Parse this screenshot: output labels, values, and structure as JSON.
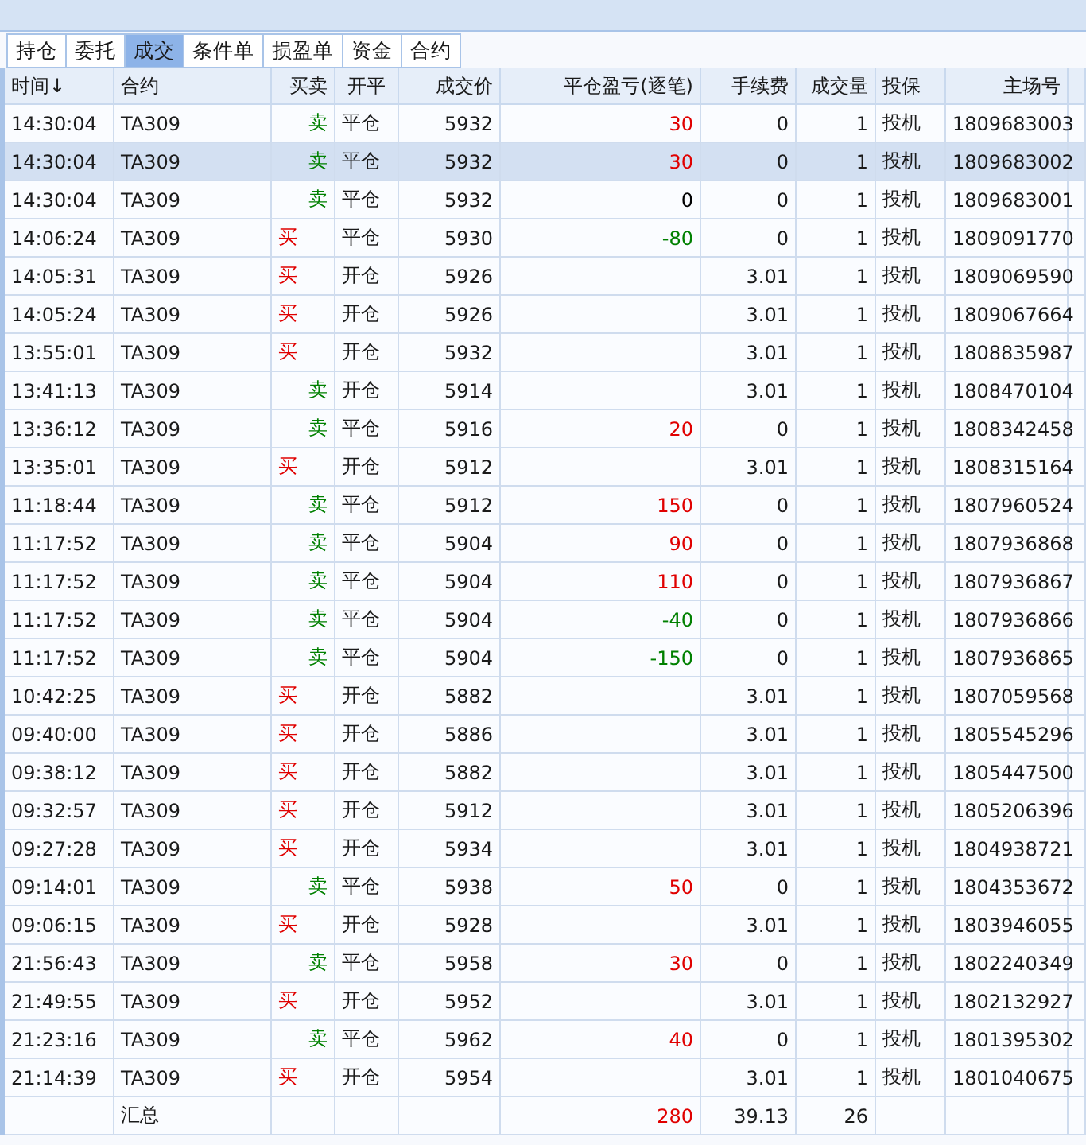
{
  "tabs": [
    {
      "label": "持仓",
      "selected": false
    },
    {
      "label": "委托",
      "selected": false
    },
    {
      "label": "成交",
      "selected": true
    },
    {
      "label": "条件单",
      "selected": false
    },
    {
      "label": "损盈单",
      "selected": false
    },
    {
      "label": "资金",
      "selected": false
    },
    {
      "label": "合约",
      "selected": false
    }
  ],
  "table": {
    "columns": [
      "时间↓",
      "合约",
      "买卖",
      "开平",
      "成交价",
      "平仓盈亏(逐笔)",
      "手续费",
      "成交量",
      "投保",
      "主场号"
    ],
    "rows": [
      {
        "time": "14:30:04",
        "contract": "TA309",
        "side": "卖",
        "kind": "sell",
        "oc": "平仓",
        "price": "5932",
        "pnl": "30",
        "color": "#e00000",
        "fee": "0",
        "volume": "1",
        "hedge": "投机",
        "id": "1809683003",
        "selected": false
      },
      {
        "time": "14:30:04",
        "contract": "TA309",
        "side": "卖",
        "kind": "sell",
        "oc": "平仓",
        "price": "5932",
        "pnl": "30",
        "color": "#e00000",
        "fee": "0",
        "volume": "1",
        "hedge": "投机",
        "id": "1809683002",
        "selected": true
      },
      {
        "time": "14:30:04",
        "contract": "TA309",
        "side": "卖",
        "kind": "sell",
        "oc": "平仓",
        "price": "5932",
        "pnl": "0",
        "color": "#000000",
        "fee": "0",
        "volume": "1",
        "hedge": "投机",
        "id": "1809683001",
        "selected": false
      },
      {
        "time": "14:06:24",
        "contract": "TA309",
        "side": "买",
        "kind": "buy",
        "oc": "平仓",
        "price": "5930",
        "pnl": "-80",
        "color": "#008000",
        "fee": "0",
        "volume": "1",
        "hedge": "投机",
        "id": "1809091770",
        "selected": false
      },
      {
        "time": "14:05:31",
        "contract": "TA309",
        "side": "买",
        "kind": "buy",
        "oc": "开仓",
        "price": "5926",
        "fee": "3.01",
        "volume": "1",
        "hedge": "投机",
        "id": "1809069590",
        "selected": false
      },
      {
        "time": "14:05:24",
        "contract": "TA309",
        "side": "买",
        "kind": "buy",
        "oc": "开仓",
        "price": "5926",
        "fee": "3.01",
        "volume": "1",
        "hedge": "投机",
        "id": "1809067664",
        "selected": false
      },
      {
        "time": "13:55:01",
        "contract": "TA309",
        "side": "买",
        "kind": "buy",
        "oc": "开仓",
        "price": "5932",
        "fee": "3.01",
        "volume": "1",
        "hedge": "投机",
        "id": "1808835987",
        "selected": false
      },
      {
        "time": "13:41:13",
        "contract": "TA309",
        "side": "卖",
        "kind": "sell",
        "oc": "开仓",
        "price": "5914",
        "fee": "3.01",
        "volume": "1",
        "hedge": "投机",
        "id": "1808470104",
        "selected": false
      },
      {
        "time": "13:36:12",
        "contract": "TA309",
        "side": "卖",
        "kind": "sell",
        "oc": "平仓",
        "price": "5916",
        "pnl": "20",
        "color": "#e00000",
        "fee": "0",
        "volume": "1",
        "hedge": "投机",
        "id": "1808342458",
        "selected": false
      },
      {
        "time": "13:35:01",
        "contract": "TA309",
        "side": "买",
        "kind": "buy",
        "oc": "开仓",
        "price": "5912",
        "fee": "3.01",
        "volume": "1",
        "hedge": "投机",
        "id": "1808315164",
        "selected": false
      },
      {
        "time": "11:18:44",
        "contract": "TA309",
        "side": "卖",
        "kind": "sell",
        "oc": "平仓",
        "price": "5912",
        "pnl": "150",
        "color": "#e00000",
        "fee": "0",
        "volume": "1",
        "hedge": "投机",
        "id": "1807960524",
        "selected": false
      },
      {
        "time": "11:17:52",
        "contract": "TA309",
        "side": "卖",
        "kind": "sell",
        "oc": "平仓",
        "price": "5904",
        "pnl": "90",
        "color": "#e00000",
        "fee": "0",
        "volume": "1",
        "hedge": "投机",
        "id": "1807936868",
        "selected": false
      },
      {
        "time": "11:17:52",
        "contract": "TA309",
        "side": "卖",
        "kind": "sell",
        "oc": "平仓",
        "price": "5904",
        "pnl": "110",
        "color": "#e00000",
        "fee": "0",
        "volume": "1",
        "hedge": "投机",
        "id": "1807936867",
        "selected": false
      },
      {
        "time": "11:17:52",
        "contract": "TA309",
        "side": "卖",
        "kind": "sell",
        "oc": "平仓",
        "price": "5904",
        "pnl": "-40",
        "color": "#008000",
        "fee": "0",
        "volume": "1",
        "hedge": "投机",
        "id": "1807936866",
        "selected": false
      },
      {
        "time": "11:17:52",
        "contract": "TA309",
        "side": "卖",
        "kind": "sell",
        "oc": "平仓",
        "price": "5904",
        "pnl": "-150",
        "color": "#008000",
        "fee": "0",
        "volume": "1",
        "hedge": "投机",
        "id": "1807936865",
        "selected": false
      },
      {
        "time": "10:42:25",
        "contract": "TA309",
        "side": "买",
        "kind": "buy",
        "oc": "开仓",
        "price": "5882",
        "fee": "3.01",
        "volume": "1",
        "hedge": "投机",
        "id": "1807059568",
        "selected": false
      },
      {
        "time": "09:40:00",
        "contract": "TA309",
        "side": "买",
        "kind": "buy",
        "oc": "开仓",
        "price": "5886",
        "fee": "3.01",
        "volume": "1",
        "hedge": "投机",
        "id": "1805545296",
        "selected": false
      },
      {
        "time": "09:38:12",
        "contract": "TA309",
        "side": "买",
        "kind": "buy",
        "oc": "开仓",
        "price": "5882",
        "fee": "3.01",
        "volume": "1",
        "hedge": "投机",
        "id": "1805447500",
        "selected": false
      },
      {
        "time": "09:32:57",
        "contract": "TA309",
        "side": "买",
        "kind": "buy",
        "oc": "开仓",
        "price": "5912",
        "fee": "3.01",
        "volume": "1",
        "hedge": "投机",
        "id": "1805206396",
        "selected": false
      },
      {
        "time": "09:27:28",
        "contract": "TA309",
        "side": "买",
        "kind": "buy",
        "oc": "开仓",
        "price": "5934",
        "fee": "3.01",
        "volume": "1",
        "hedge": "投机",
        "id": "1804938721",
        "selected": false
      },
      {
        "time": "09:14:01",
        "contract": "TA309",
        "side": "卖",
        "kind": "sell",
        "oc": "平仓",
        "price": "5938",
        "pnl": "50",
        "color": "#e00000",
        "fee": "0",
        "volume": "1",
        "hedge": "投机",
        "id": "1804353672",
        "selected": false
      },
      {
        "time": "09:06:15",
        "contract": "TA309",
        "side": "买",
        "kind": "buy",
        "oc": "开仓",
        "price": "5928",
        "fee": "3.01",
        "volume": "1",
        "hedge": "投机",
        "id": "1803946055",
        "selected": false
      },
      {
        "time": "21:56:43",
        "contract": "TA309",
        "side": "卖",
        "kind": "sell",
        "oc": "平仓",
        "price": "5958",
        "pnl": "30",
        "color": "#e00000",
        "fee": "0",
        "volume": "1",
        "hedge": "投机",
        "id": "1802240349",
        "selected": false
      },
      {
        "time": "21:49:55",
        "contract": "TA309",
        "side": "买",
        "kind": "buy",
        "oc": "开仓",
        "price": "5952",
        "fee": "3.01",
        "volume": "1",
        "hedge": "投机",
        "id": "1802132927",
        "selected": false
      },
      {
        "time": "21:23:16",
        "contract": "TA309",
        "side": "卖",
        "kind": "sell",
        "oc": "平仓",
        "price": "5962",
        "pnl": "40",
        "color": "#e00000",
        "fee": "0",
        "volume": "1",
        "hedge": "投机",
        "id": "1801395302",
        "selected": false
      },
      {
        "time": "21:14:39",
        "contract": "TA309",
        "side": "买",
        "kind": "buy",
        "oc": "开仓",
        "price": "5954",
        "fee": "3.01",
        "volume": "1",
        "hedge": "投机",
        "id": "1801040675",
        "selected": false
      }
    ],
    "summary": {
      "label": "汇总",
      "pnl": "280",
      "color": "#e00000",
      "fee": "39.13",
      "volume": "26"
    }
  }
}
